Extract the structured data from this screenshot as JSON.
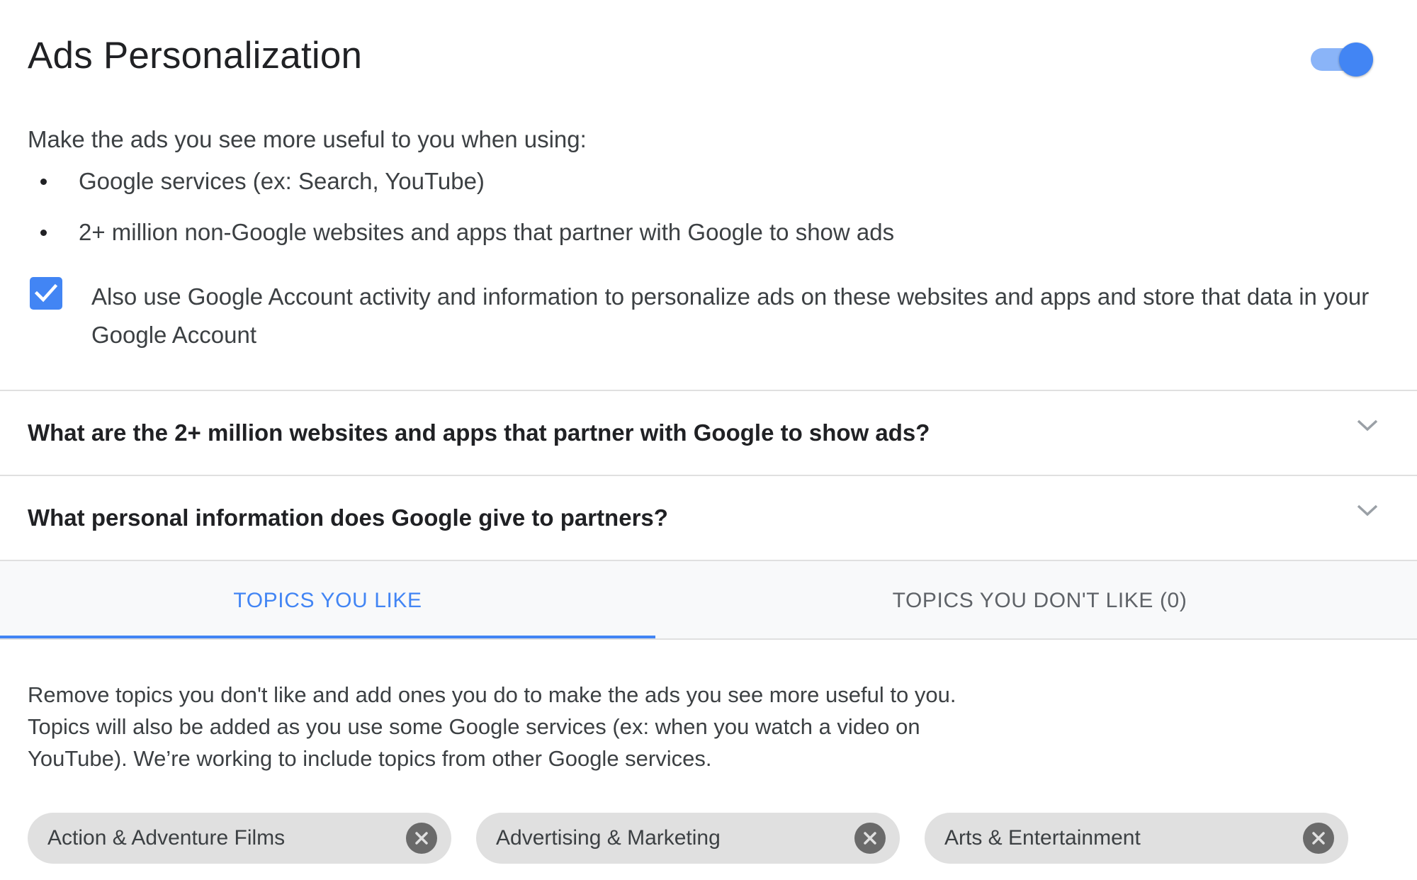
{
  "header": {
    "title": "Ads Personalization",
    "toggle_state": "on"
  },
  "intro": {
    "text": "Make the ads you see more useful to you when using:",
    "bullets": [
      "Google services (ex: Search, YouTube)",
      "2+ million non-Google websites and apps that partner with Google to show ads"
    ]
  },
  "checkbox": {
    "checked": true,
    "label": "Also use Google Account activity and information to personalize ads on these websites and apps and store that data in your Google Account"
  },
  "accordions": [
    {
      "question": "What are the 2+ million websites and apps that partner with Google to show ads?"
    },
    {
      "question": "What personal information does Google give to partners?"
    }
  ],
  "tabs": [
    {
      "label": "TOPICS YOU LIKE",
      "active": true
    },
    {
      "label": "TOPICS YOU DON'T LIKE (0)",
      "active": false
    }
  ],
  "topics": {
    "description": "Remove topics you don't like and add ones you do to make the ads you see more useful to you. Topics will also be added as you use some Google services (ex: when you watch a video on YouTube). We’re working to include topics from other Google services.",
    "chips": [
      "Action & Adventure Films",
      "Advertising & Marketing",
      "Arts & Entertainment"
    ]
  },
  "colors": {
    "accent": "#4285f4",
    "toggle_track": "#8ab4f8",
    "chip_bg": "#e0e0e0",
    "divider": "#e0e0e0",
    "tab_bar_bg": "#f8f9fa"
  },
  "icons": {
    "checkbox": "checkmark-icon",
    "accordion": "chevron-down-icon",
    "chip_remove": "close-circle-icon"
  }
}
